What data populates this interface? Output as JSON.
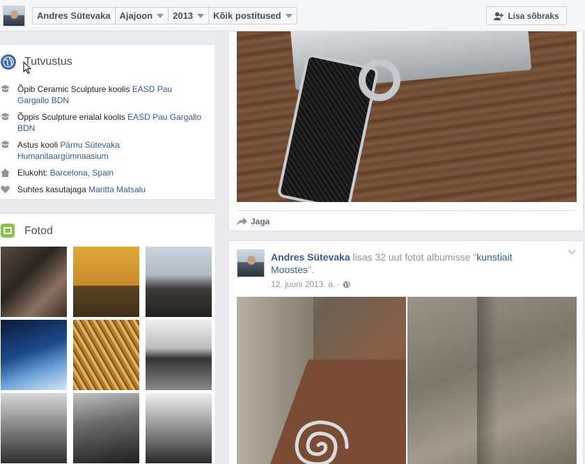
{
  "topbar": {
    "crumbs": [
      "Andres Sütevaka",
      "Ajajoon",
      "2013",
      "Kõik postitused"
    ],
    "add_friend_label": "Lisa sõbraks"
  },
  "intro": {
    "title": "Tutvustus",
    "items": [
      {
        "icon": "school-icon",
        "prefix": "Õpib Ceramic Sculpture koolis ",
        "link": "EASD Pau Gargallo BDN"
      },
      {
        "icon": "school-icon",
        "prefix": "Õppis Sculpture erialal koolis ",
        "link": "EASD Pau Gargallo BDN"
      },
      {
        "icon": "school-icon",
        "prefix": "Astus kooli ",
        "link": "Pärnu Sütevaka Humanitaargümnaasium"
      },
      {
        "icon": "home-icon",
        "prefix": "Elukoht: ",
        "link": "Barcelona, Spain"
      },
      {
        "icon": "heart-icon",
        "prefix": "Suhtes kasutajaga ",
        "link": "Maritta Matsalu"
      }
    ]
  },
  "photos": {
    "title": "Fotod"
  },
  "post1": {
    "share_label": "Jaga"
  },
  "post2": {
    "author": "Andres Sütevaka",
    "action": " lisas 32 uut fotot albumisse \"",
    "album": "kunstiait Moostes",
    "action_end": "\".",
    "date": "12. juuni 2013. a. ·"
  },
  "colors": {
    "link": "#365899",
    "accent": "#4267b2",
    "photos_icon": "#8bc34a"
  }
}
